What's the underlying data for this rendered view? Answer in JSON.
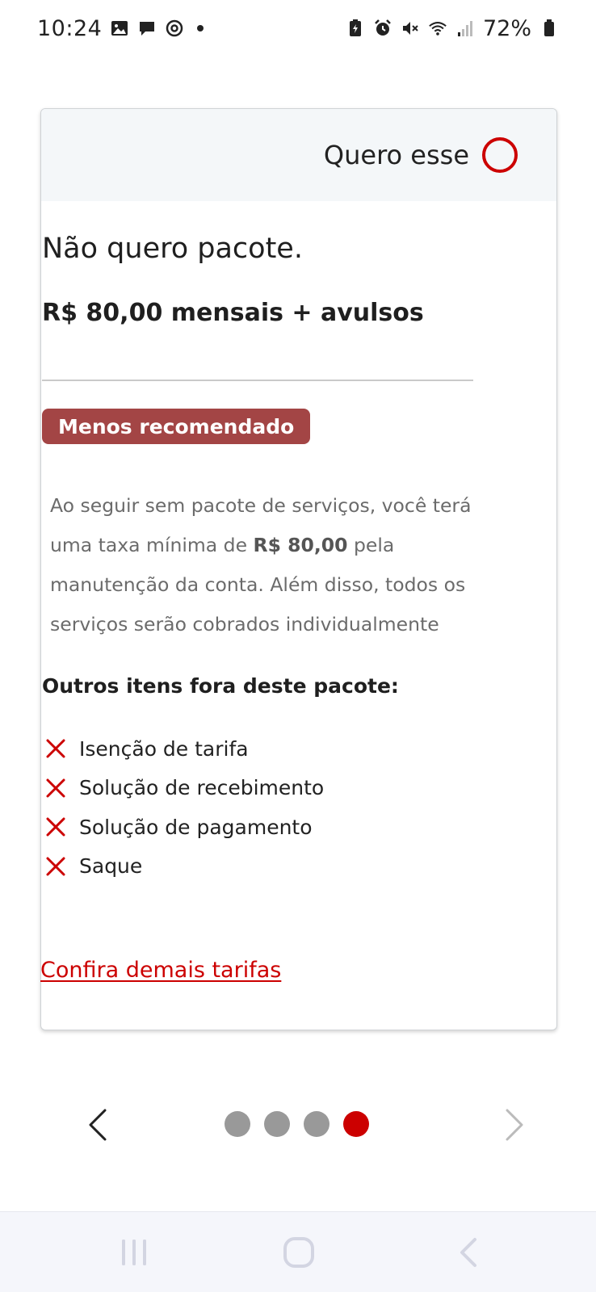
{
  "status_bar": {
    "time": "10:24",
    "battery": "72%",
    "left_icons": [
      "gallery-icon",
      "chat-bubble-icon",
      "threads-icon"
    ],
    "right_icons": [
      "battery-saver-icon",
      "alarm-icon",
      "mute-icon",
      "wifi-icon",
      "signal-icon",
      "battery-icon"
    ]
  },
  "card": {
    "choose_label": "Quero esse",
    "plan_name": "Não quero pacote.",
    "price": "R$ 80,00 mensais + avulsos",
    "badge": "Menos recomendado",
    "description": {
      "part1": "Ao seguir sem pacote de serviços, você terá uma taxa mínima de ",
      "highlight": "R$ 80,00",
      "part2": " pela manutenção da conta. Além disso, todos os serviços serão cobrados individualmente"
    },
    "others_title": "Outros itens fora deste pacote:",
    "features": [
      "Isenção de tarifa",
      "Solução de recebimento",
      "Solução de pagamento",
      "Saque"
    ],
    "link": "Confira demais tarifas"
  },
  "pager": {
    "total": 4,
    "current": 4
  },
  "colors": {
    "accent": "#cc0000",
    "badge": "#a34545",
    "inactive_dot": "#999999"
  }
}
